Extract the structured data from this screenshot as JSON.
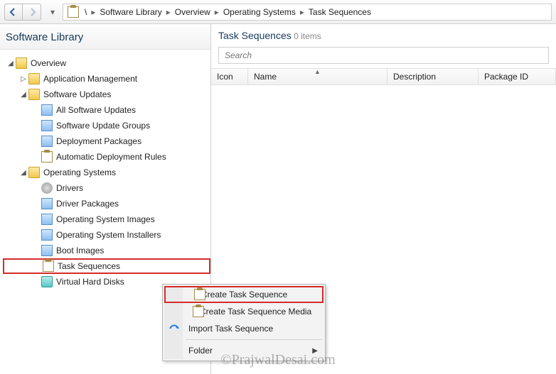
{
  "breadcrumb": {
    "root": "\\",
    "items": [
      "Software Library",
      "Overview",
      "Operating Systems",
      "Task Sequences"
    ]
  },
  "sidebar": {
    "title": "Software Library",
    "nodes": {
      "overview": "Overview",
      "app_mgmt": "Application Management",
      "sw_updates": "Software Updates",
      "all_sw_updates": "All Software Updates",
      "sw_upd_groups": "Software Update Groups",
      "deploy_pkgs": "Deployment Packages",
      "auto_deploy_rules": "Automatic Deployment Rules",
      "os": "Operating Systems",
      "drivers": "Drivers",
      "driver_pkgs": "Driver Packages",
      "os_images": "Operating System Images",
      "os_installers": "Operating System Installers",
      "boot_images": "Boot Images",
      "task_seq": "Task Sequences",
      "vhd": "Virtual Hard Disks"
    }
  },
  "content": {
    "title": "Task Sequences",
    "count_label": "0 items",
    "search_placeholder": "Search",
    "columns": {
      "icon": "Icon",
      "name": "Name",
      "description": "Description",
      "package_id": "Package ID"
    }
  },
  "context_menu": {
    "create_ts": "Create Task Sequence",
    "create_ts_media": "Create Task Sequence Media",
    "import_ts": "Import Task Sequence",
    "folder": "Folder"
  },
  "watermark": "©PrajwalDesai.com"
}
